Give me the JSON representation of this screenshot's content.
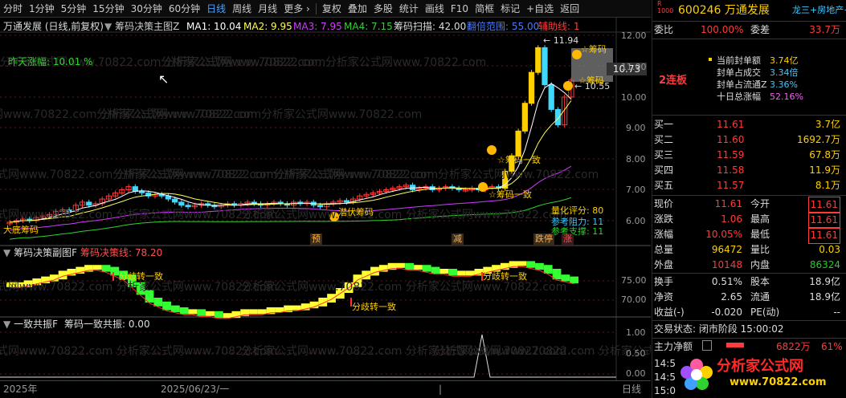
{
  "toolbar": {
    "items": [
      "分时",
      "1分钟",
      "5分钟",
      "15分钟",
      "30分钟",
      "60分钟",
      "日线",
      "周线",
      "月线",
      "更多 ›",
      "复权",
      "叠加",
      "多股",
      "统计",
      "画线",
      "F10",
      "简框",
      "标记",
      "+自选",
      "返回"
    ],
    "active": "日线"
  },
  "main_header": {
    "title": "万通发展 (日线,前复权)",
    "indicator": "筹码决策主图Z",
    "ma1": "MA1: 10.04",
    "ma2": "MA2: 9.95",
    "ma3": "MA3: 7.95",
    "ma4": "MA4: 7.15",
    "scan": "筹码扫描: 42.00",
    "range": "翻倍范围: 55.00",
    "aux": "辅助线: 1"
  },
  "main_labels": {
    "prev_gain": "昨天涨幅:  10.01 %",
    "high_price": "11.94",
    "low_marker": "10.55",
    "price_box": "10.73",
    "chip1": "筹码",
    "chip2": "筹码",
    "consist1": "☆筹码一致",
    "consist2": "☆筹码一致",
    "ambush": "潜伏筹码",
    "left_label": "大底筹码",
    "quant_score": "量化评分: 80",
    "resist": "参考阻力: 11",
    "support": "参考支撑: 11",
    "tag_yu": "预",
    "tag_jian": "减",
    "tag_dieting": "跌停",
    "tag_zhang": "涨"
  },
  "y_axis": {
    "main": [
      "12.00",
      "11.00",
      "10.00",
      "9.00",
      "8.00",
      "7.00",
      "6.00"
    ],
    "sub": [
      "75.00",
      "70.00"
    ],
    "vol": [
      "1.00",
      "0.50",
      "0.00"
    ]
  },
  "sub_header": {
    "title": "筹码决策副图F",
    "line": "筹码决策线: 78.20"
  },
  "sub_labels": {
    "div1": "分歧转一致",
    "div2": "分歧转一致",
    "div3": "分歧转一致"
  },
  "vol_header": {
    "title": "一致共振F",
    "line": "筹码一致共振: 0.00"
  },
  "footer": {
    "year": "2025年",
    "date": "2025/06/23/一",
    "date_bar": "|",
    "right": "日线"
  },
  "watermark": "分析家公式网www.70822.com",
  "right_panel": {
    "code": "600246",
    "name": "万通发展",
    "tag_r": "R",
    "tag_num": "1000",
    "concept": "龙三+房地产+芯",
    "weibi_label": "委比",
    "weibi": "100.00%",
    "weicha_label": "委差",
    "weicha": "33.7万",
    "info": [
      {
        "label": "当前封单额",
        "value": "3.74亿"
      },
      {
        "label": "封单占成交",
        "value": "3.34倍"
      },
      {
        "label": "封单占流通Z",
        "value": "3.36%"
      },
      {
        "label": "十日总涨幅",
        "value": "52.16%"
      }
    ],
    "lianban": "2连板",
    "bids": [
      {
        "label": "买一",
        "price": "11.61",
        "vol": "3.7亿"
      },
      {
        "label": "买二",
        "price": "11.60",
        "vol": "1692.7万"
      },
      {
        "label": "买三",
        "price": "11.59",
        "vol": "67.8万"
      },
      {
        "label": "买四",
        "price": "11.58",
        "vol": "11.9万"
      },
      {
        "label": "买五",
        "price": "11.57",
        "vol": "8.1万"
      }
    ],
    "stats": [
      {
        "l1": "现价",
        "v1": "11.61",
        "l2": "今开",
        "v2": "11.61"
      },
      {
        "l1": "涨跌",
        "v1": "1.06",
        "l2": "最高",
        "v2": "11.61"
      },
      {
        "l1": "涨幅",
        "v1": "10.05%",
        "l2": "最低",
        "v2": "11.61"
      },
      {
        "l1": "总量",
        "v1": "96472",
        "l2": "量比",
        "v2": "0.03"
      },
      {
        "l1": "外盘",
        "v1": "10148",
        "l2": "内盘",
        "v2": "86324"
      }
    ],
    "stats2": [
      {
        "l1": "换手",
        "v1": "0.51%",
        "l2": "股本",
        "v2": "18.9亿"
      },
      {
        "l1": "净资",
        "v1": "2.65",
        "l2": "流通",
        "v2": "18.9亿"
      },
      {
        "l1": "收益(-)",
        "v1": "-0.020",
        "l2": "PE(动)",
        "v2": "--"
      }
    ],
    "trade_state": "交易状态: 闭市阶段 15:00:02",
    "net_flow_label": "主力净额",
    "net_flow": "6822万",
    "net_pct": "61%",
    "times": [
      "14:5",
      "14:5",
      "15:0"
    ],
    "logo_text": "分析家公式网",
    "logo_url": "www.70822.com"
  },
  "colors": {
    "up": "#ff3b3b",
    "down": "#3fd8ff",
    "ma1": "#ffffff",
    "ma2": "#ffff55",
    "ma3": "#d23cff",
    "ma4": "#2fd32f",
    "accent": "#4aa3ff"
  }
}
